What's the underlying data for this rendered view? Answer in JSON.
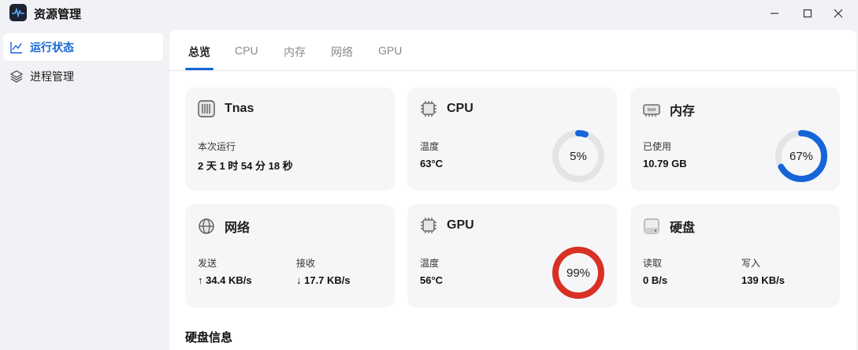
{
  "app": {
    "title": "资源管理"
  },
  "sidebar": {
    "items": [
      {
        "label": "运行状态",
        "icon": "line-chart-icon",
        "active": true
      },
      {
        "label": "进程管理",
        "icon": "layers-icon",
        "active": false
      }
    ]
  },
  "tabs": [
    "总览",
    "CPU",
    "内存",
    "网络",
    "GPU"
  ],
  "cards": {
    "system": {
      "title": "Tnas",
      "label": "本次运行",
      "value": "2 天 1 时 54 分 18 秒"
    },
    "cpu": {
      "title": "CPU",
      "label": "温度",
      "value": "63°C",
      "usage_text": "5%",
      "usage": 5,
      "color": "#1565d8"
    },
    "memory": {
      "title": "内存",
      "label": "已使用",
      "value": "10.79 GB",
      "usage_text": "67%",
      "usage": 67,
      "color": "#1565d8"
    },
    "network": {
      "title": "网络",
      "send_label": "发送",
      "send_value": "↑ 34.4 KB/s",
      "recv_label": "接收",
      "recv_value": "↓ 17.7 KB/s"
    },
    "gpu": {
      "title": "GPU",
      "label": "温度",
      "value": "56°C",
      "usage_text": "99%",
      "usage": 99,
      "color": "#d93025"
    },
    "disk": {
      "title": "硬盘",
      "read_label": "读取",
      "read_value": "0 B/s",
      "write_label": "写入",
      "write_value": "139 KB/s"
    }
  },
  "section": {
    "disk_info_title": "硬盘信息"
  }
}
